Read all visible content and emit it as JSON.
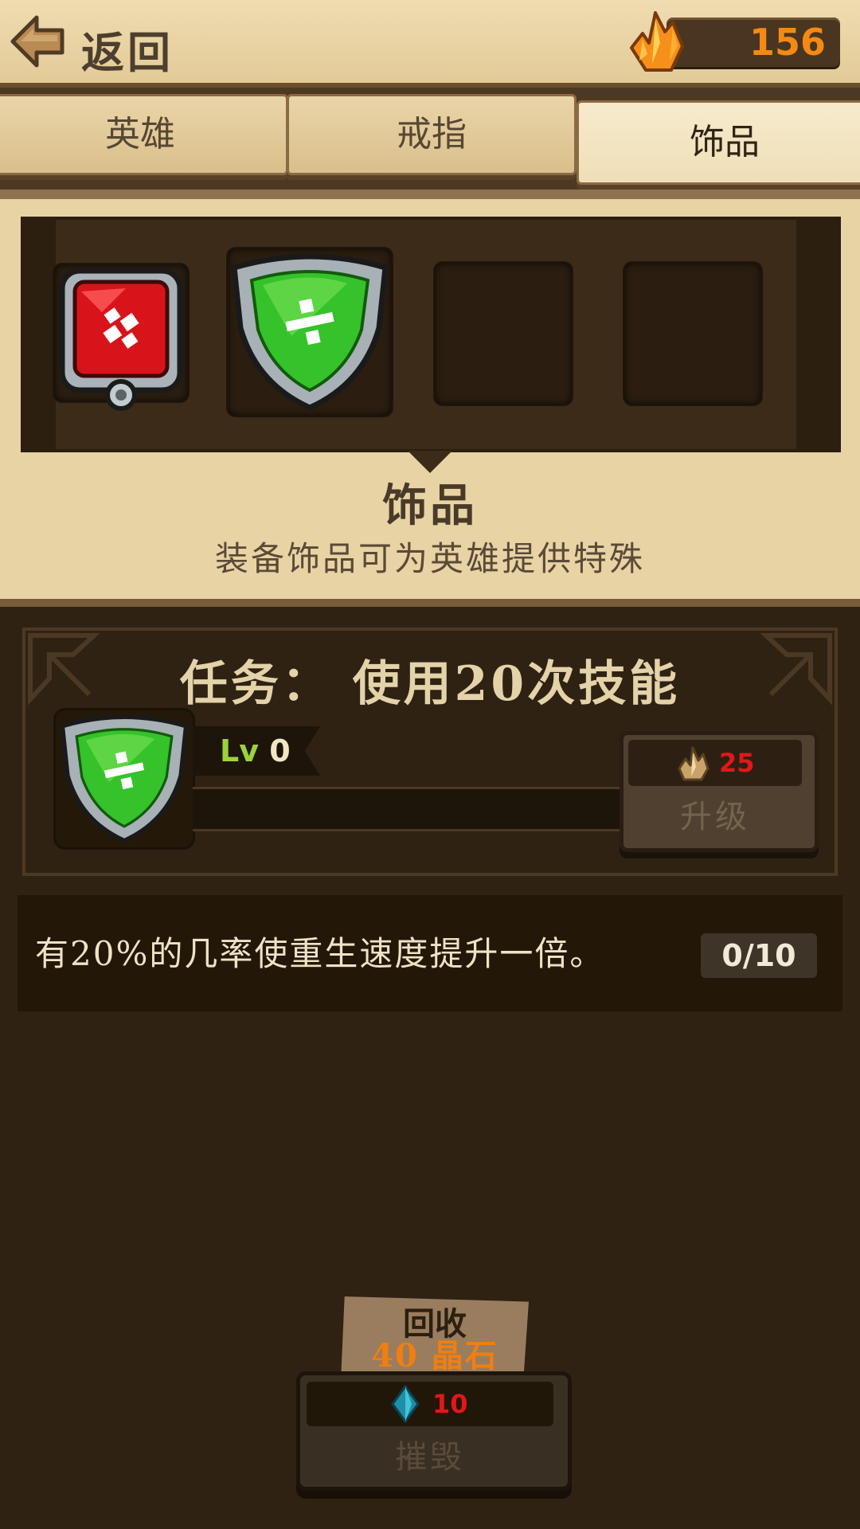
{
  "header": {
    "back_label": "返回",
    "crystals": "156"
  },
  "tabs": [
    {
      "label": "英雄",
      "active": false
    },
    {
      "label": "戒指",
      "active": false
    },
    {
      "label": "饰品",
      "active": true
    }
  ],
  "inventory": {
    "slots": [
      {
        "item": "red-amulet-icon"
      },
      {
        "item": "green-shield-icon"
      },
      {
        "item": "empty"
      },
      {
        "item": "empty"
      }
    ],
    "title": "饰品",
    "description": "装备饰品可为英雄提供特殊"
  },
  "quest": {
    "title_prefix": "任务：",
    "title_text": "使用20次技能",
    "level_prefix": "Lv",
    "level": "0",
    "upgrade_cost": "25",
    "upgrade_label": "升级",
    "progress": 0
  },
  "effect": {
    "text": "有20%的几率使重生速度提升一倍。",
    "count": "0/10"
  },
  "recycle": {
    "line1": "回收",
    "line2": "40 晶石"
  },
  "destroy": {
    "cost": "10",
    "label": "摧毁"
  },
  "colors": {
    "background": "#2f2213",
    "parchment": "#efdcb1",
    "crystal_orange": "#f48a14",
    "cost_red": "#e4161a",
    "level_green": "#9bd23c"
  }
}
